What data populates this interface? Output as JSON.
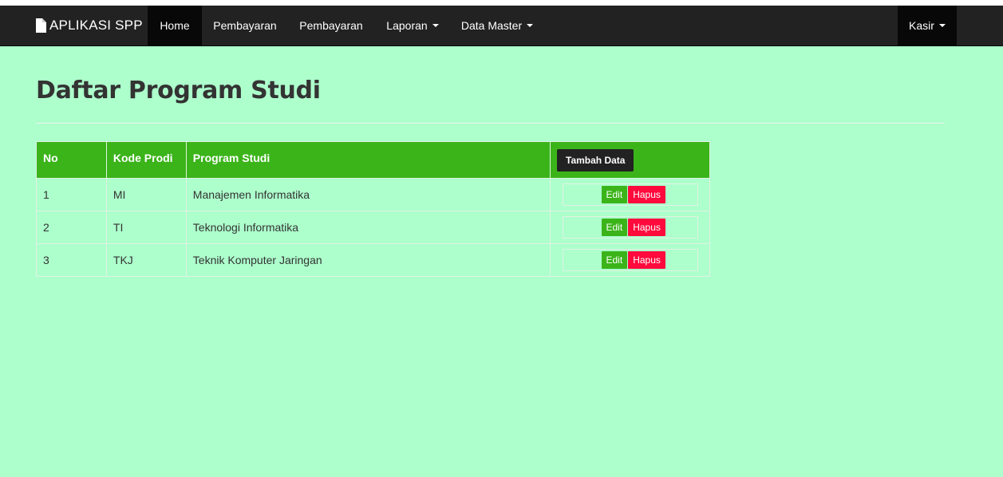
{
  "navbar": {
    "brand": "APLIKASI SPP",
    "items": [
      {
        "label": "Home",
        "active": true
      },
      {
        "label": "Pembayaran"
      },
      {
        "label": "Pembayaran"
      },
      {
        "label": "Laporan",
        "dropdown": true
      },
      {
        "label": "Data Master",
        "dropdown": true
      }
    ],
    "user_menu": "Kasir"
  },
  "page": {
    "title": "Daftar Program Studi"
  },
  "table": {
    "headers": {
      "no": "No",
      "kode": "Kode Prodi",
      "prodi": "Program Studi",
      "add_button": "Tambah Data"
    },
    "rows": [
      {
        "no": "1",
        "kode": "MI",
        "prodi": "Manajemen Informatika",
        "edit": "Edit",
        "delete": "Hapus"
      },
      {
        "no": "2",
        "kode": "TI",
        "prodi": "Teknologi Informatika",
        "edit": "Edit",
        "delete": "Hapus"
      },
      {
        "no": "3",
        "kode": "TKJ",
        "prodi": "Teknik Komputer Jaringan",
        "edit": "Edit",
        "delete": "Hapus"
      }
    ]
  },
  "colors": {
    "page_background": "#adffcc",
    "navbar": "#222222",
    "header_green": "#3bb41a",
    "delete_red": "#ff0a3c"
  },
  "icons": {
    "brand": "file-icon",
    "dropdown": "caret-down-icon"
  }
}
